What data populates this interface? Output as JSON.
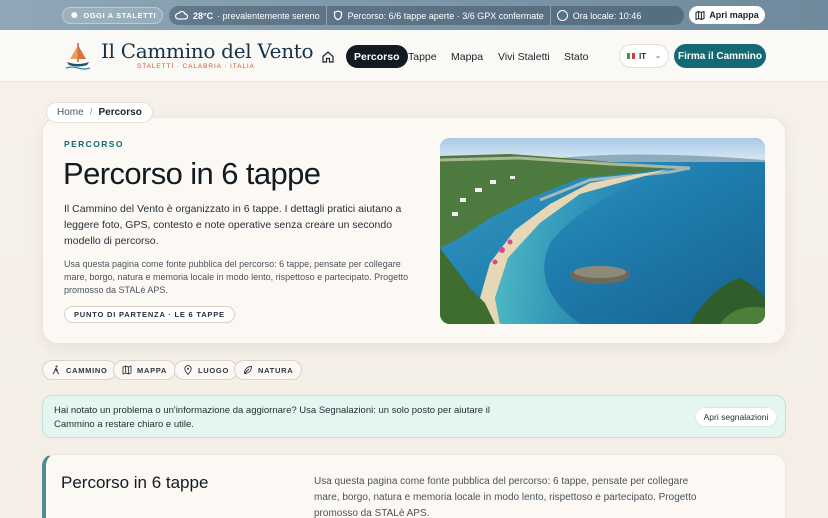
{
  "topbar": {
    "today_label": "OGGI A STALETTI",
    "weather_temp": "28°C",
    "weather_desc": "· prevalentemente sereno",
    "route_status": "Percorso: 6/6 tappe aperte · 3/6 GPX confermate",
    "local_time": "Ora locale: 10:46",
    "map_button": "Apri mappa"
  },
  "brand": {
    "title": "Il Cammino del Vento",
    "subtitle": "STALETTÌ · CALABRIA · ITALIA"
  },
  "nav": {
    "items": [
      {
        "label": "Percorso",
        "active": true
      },
      {
        "label": "Tappe"
      },
      {
        "label": "Mappa"
      },
      {
        "label": "Vivi Staletti"
      },
      {
        "label": "Stato"
      }
    ],
    "lang": "IT",
    "cta": "Firma il Cammino"
  },
  "breadcrumb": {
    "home": "Home",
    "separator": "/",
    "current": "Percorso"
  },
  "hero": {
    "eyebrow": "PERCORSO",
    "title": "Percorso in 6 tappe",
    "lead": "Il Cammino del Vento è organizzato in 6 tappe. I dettagli pratici aiutano a leggere foto, GPS, contesto e note operative senza creare un secondo modello di percorso.",
    "body": "Usa questa pagina come fonte pubblica del percorso: 6 tappe, pensate per collegare mare, borgo, natura e memoria locale in modo lento, rispettoso e partecipato. Progetto promosso da STALè APS.",
    "chip": "PUNTO DI PARTENZA · LE 6 TAPPE"
  },
  "tags": [
    {
      "label": "CAMMINO",
      "icon": "walker-icon"
    },
    {
      "label": "MAPPA",
      "icon": "map-icon"
    },
    {
      "label": "LUOGO",
      "icon": "pin-icon"
    },
    {
      "label": "NATURA",
      "icon": "leaf-icon"
    }
  ],
  "banner": {
    "text": "Hai notato un problema o un'informazione da aggiornare? Usa Segnalazioni: un solo posto per aiutare il Cammino a restare chiaro e utile.",
    "button": "Apri segnalazioni"
  },
  "section": {
    "title": "Percorso in 6 tappe",
    "body": "Usa questa pagina come fonte pubblica del percorso: 6 tappe, pensate per collegare mare, borgo, natura e memoria locale in modo lento, rispettoso e partecipato. Progetto promosso da STALè APS."
  },
  "colors": {
    "accent": "#136a75",
    "brand_red": "#c25d3a",
    "nav_active": "#121a22"
  }
}
